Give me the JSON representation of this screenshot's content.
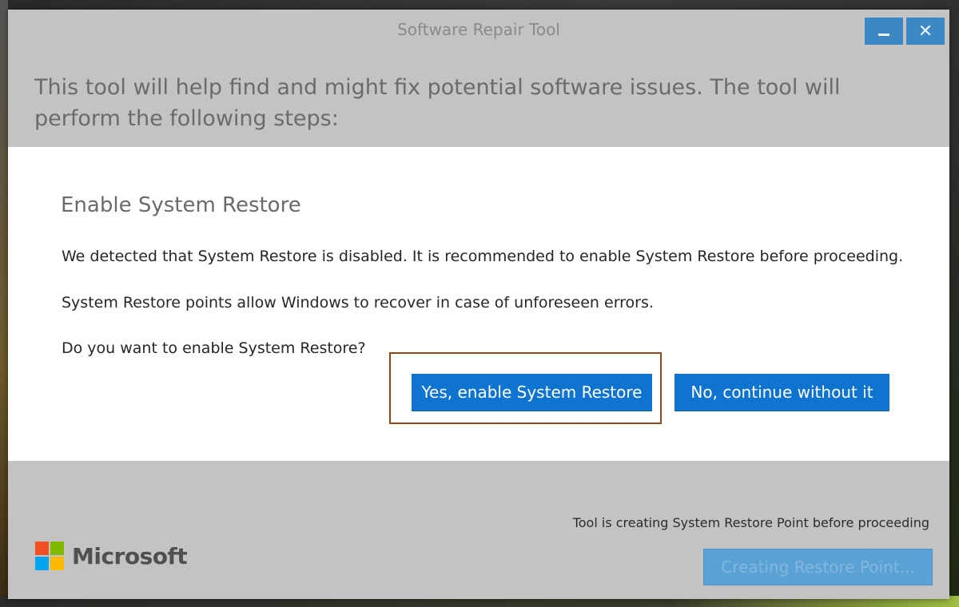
{
  "window": {
    "title": "Software Repair Tool",
    "minimize_symbol": "–",
    "close_symbol": "✕"
  },
  "intro": {
    "text": "This tool will help find and might fix potential software issues. The tool will perform the following steps:"
  },
  "panel": {
    "heading": "Enable System Restore",
    "paragraph1": "We detected that System Restore is disabled. It is recommended to enable System Restore before proceeding.",
    "paragraph2": "System Restore points allow Windows to recover in case of unforeseen errors.",
    "question": "Do you want to enable System Restore?",
    "yes_button": "Yes, enable System Restore",
    "no_button": "No, continue without it"
  },
  "footer": {
    "status_text": "Tool is creating System Restore Point before proceeding",
    "progress_button": "Creating Restore Point...",
    "brand": "Microsoft"
  },
  "colors": {
    "accent": "#0f74d0",
    "window_gray": "#c3c3c3",
    "highlight_border": "#8a4a1a",
    "logo_red": "#f25022",
    "logo_green": "#7fba00",
    "logo_blue": "#00a4ef",
    "logo_yellow": "#ffb900"
  },
  "icons": {
    "minimize": "minimize-icon",
    "close": "close-icon",
    "logo": "microsoft-logo-icon"
  }
}
